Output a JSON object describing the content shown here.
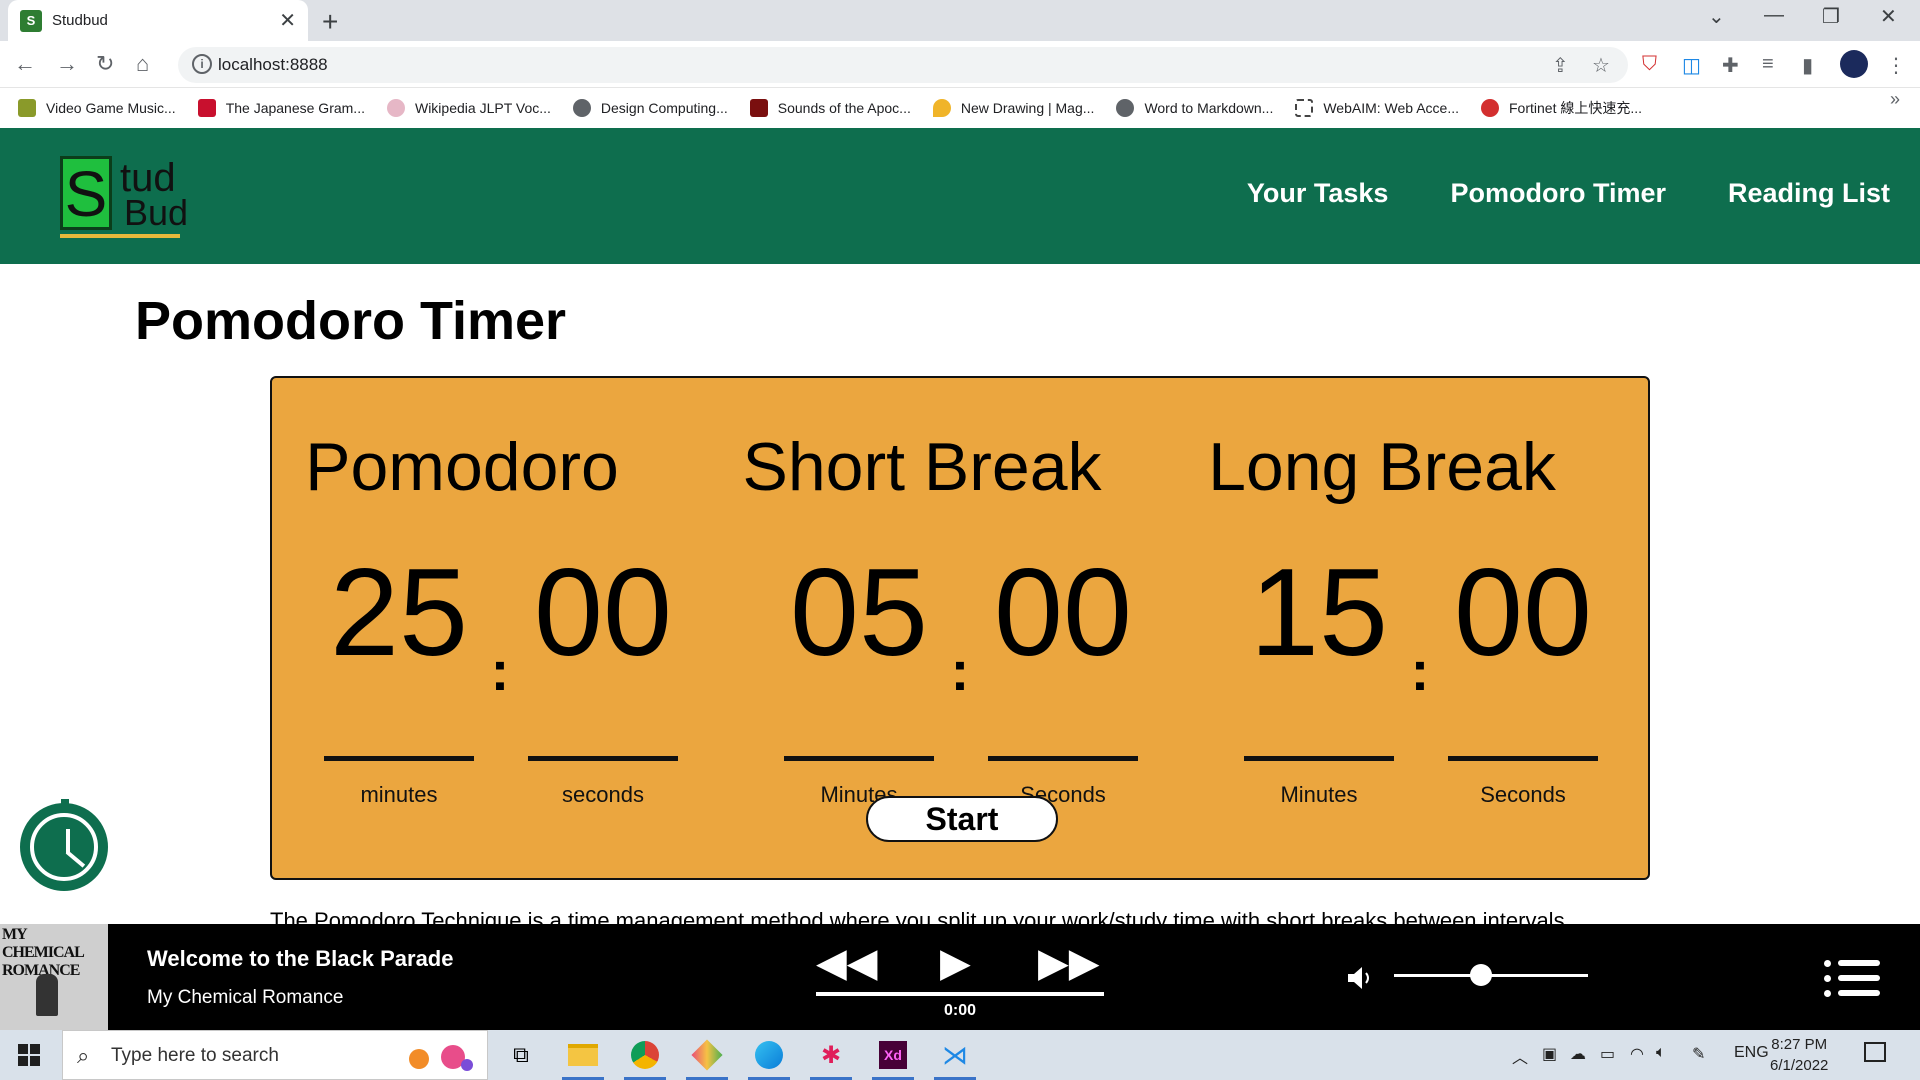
{
  "browser": {
    "tab_title": "Studbud",
    "tab_favicon": "S",
    "url": "localhost:8888",
    "bookmarks": [
      {
        "label": "Video Game Music...",
        "color": "#8a9a2a"
      },
      {
        "label": "The Japanese Gram...",
        "color": "#c8102e"
      },
      {
        "label": "Wikipedia JLPT Voc...",
        "color": "#e6b7c6"
      },
      {
        "label": "Design Computing...",
        "color": "#5f6368"
      },
      {
        "label": "Sounds of the Apoc...",
        "color": "#7a0f0f"
      },
      {
        "label": "New Drawing | Mag...",
        "color": "#f0b429"
      },
      {
        "label": "Word to Markdown...",
        "color": "#5f6368"
      },
      {
        "label": "WebAIM: Web Acce...",
        "color": "#444444"
      },
      {
        "label": "Fortinet 線上快速充...",
        "color": "#d32f2f"
      }
    ]
  },
  "site": {
    "logo_s": "S",
    "logo_tud": "tud",
    "logo_bud": "Bud",
    "nav": [
      "Your Tasks",
      "Pomodoro Timer",
      "Reading List"
    ],
    "brand_color": "#0e6e4e",
    "accent_color": "#eba63f"
  },
  "main": {
    "title": "Pomodoro Timer",
    "timers": [
      {
        "title": "Pomodoro",
        "minutes": "25",
        "seconds": "00",
        "min_label": "minutes",
        "sec_label": "seconds"
      },
      {
        "title": "Short Break",
        "minutes": "05",
        "seconds": "00",
        "min_label": "Minutes",
        "sec_label": "Seconds"
      },
      {
        "title": "Long Break",
        "minutes": "15",
        "seconds": "00",
        "min_label": "Minutes",
        "sec_label": "Seconds"
      }
    ],
    "colon": ":",
    "start_label": "Start",
    "body_text": "The Pomodoro Technique is a time management method where you split up your work/study time with short breaks between intervals."
  },
  "player": {
    "album_text": "MY CHEMICAL ROMANCE",
    "song": "Welcome to the Black Parade",
    "artist": "My Chemical Romance",
    "time": "0:00",
    "volume_fraction": 0.45
  },
  "taskbar": {
    "search_placeholder": "Type here to search",
    "lang": "ENG",
    "time": "8:27 PM",
    "date": "6/1/2022"
  }
}
